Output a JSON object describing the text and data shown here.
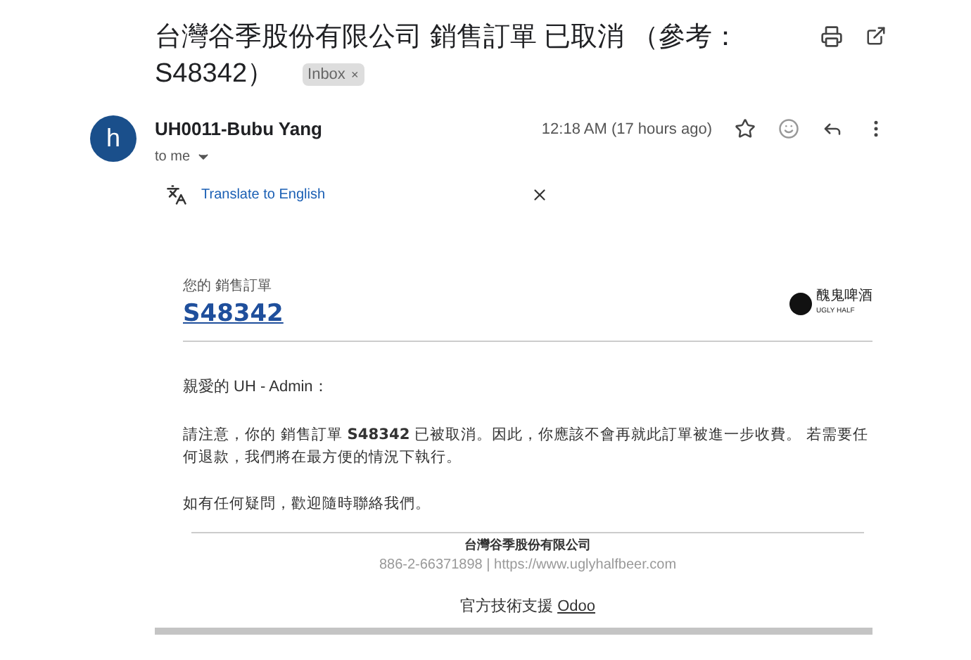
{
  "subject": {
    "title_lines": [
      "台灣谷季股份有限公司 銷售訂單 已取消 （參考：",
      "S48342）"
    ],
    "label": "Inbox",
    "label_close": "×"
  },
  "message": {
    "avatar": "h",
    "sender": "UH0011-Bubu Yang",
    "recipient": "to me",
    "time": "12:18 AM (17 hours ago)",
    "starred": false
  },
  "translate": {
    "link": "Translate to English"
  },
  "email": {
    "caption": "您的 銷售訂單",
    "order": "S48342",
    "logo_text": "醜鬼啤酒",
    "logo_sub": "UGLY HALF",
    "greeting": "親愛的 UH - Admin：",
    "paragraphs": [
      "請注意，你的 銷售訂單 **S48342** 已被取消。因此，你應該不會再就此訂單被進一步收費。 若需要任何退款，我們將在最方便的情況下執行。",
      "如有任何疑問，歡迎隨時聯絡我們。"
    ],
    "company": "台灣谷季股份有限公司",
    "contact": "886-2-66371898 | https://www.uglyhalfbeer.com",
    "powered": "官方技術支援",
    "powered_link": "Odoo"
  }
}
